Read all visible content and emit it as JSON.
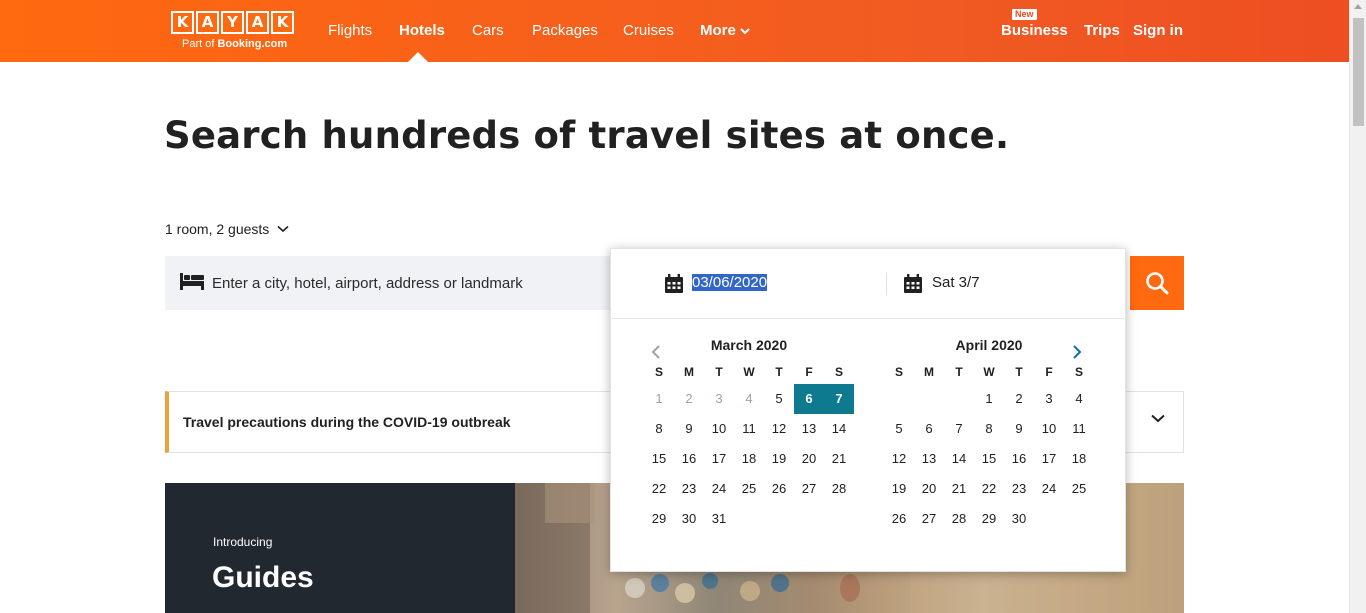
{
  "header": {
    "logo_letters": [
      "K",
      "A",
      "Y",
      "A",
      "K"
    ],
    "logo_sub_prefix": "Part of ",
    "logo_sub_brand": "Booking.com",
    "nav": {
      "flights": "Flights",
      "hotels": "Hotels",
      "cars": "Cars",
      "packages": "Packages",
      "cruises": "Cruises",
      "more": "More"
    },
    "new_badge": "New",
    "business": "Business",
    "trips": "Trips",
    "sign_in": "Sign in"
  },
  "hero": {
    "headline": "Search hundreds of travel sites at once."
  },
  "search": {
    "guests": "1 room, 2 guests",
    "destination_placeholder": "Enter a city, hotel, airport, address or landmark",
    "checkin_value": "03/06/2020",
    "checkout_value": "Sat 3/7"
  },
  "calendar": {
    "weekdays": [
      "S",
      "M",
      "T",
      "W",
      "T",
      "F",
      "S"
    ],
    "months": [
      {
        "title": "March 2020",
        "days": [
          {
            "d": "1",
            "s": "past"
          },
          {
            "d": "2",
            "s": "past"
          },
          {
            "d": "3",
            "s": "past"
          },
          {
            "d": "4",
            "s": "past"
          },
          {
            "d": "5",
            "s": ""
          },
          {
            "d": "6",
            "s": "sel"
          },
          {
            "d": "7",
            "s": "sel"
          },
          {
            "d": "8",
            "s": ""
          },
          {
            "d": "9",
            "s": ""
          },
          {
            "d": "10",
            "s": ""
          },
          {
            "d": "11",
            "s": ""
          },
          {
            "d": "12",
            "s": ""
          },
          {
            "d": "13",
            "s": ""
          },
          {
            "d": "14",
            "s": ""
          },
          {
            "d": "15",
            "s": ""
          },
          {
            "d": "16",
            "s": ""
          },
          {
            "d": "17",
            "s": ""
          },
          {
            "d": "18",
            "s": ""
          },
          {
            "d": "19",
            "s": ""
          },
          {
            "d": "20",
            "s": ""
          },
          {
            "d": "21",
            "s": ""
          },
          {
            "d": "22",
            "s": ""
          },
          {
            "d": "23",
            "s": ""
          },
          {
            "d": "24",
            "s": ""
          },
          {
            "d": "25",
            "s": ""
          },
          {
            "d": "26",
            "s": ""
          },
          {
            "d": "27",
            "s": ""
          },
          {
            "d": "28",
            "s": ""
          },
          {
            "d": "29",
            "s": ""
          },
          {
            "d": "30",
            "s": ""
          },
          {
            "d": "31",
            "s": ""
          }
        ],
        "lead_blanks": 0
      },
      {
        "title": "April 2020",
        "days": [
          {
            "d": "1",
            "s": ""
          },
          {
            "d": "2",
            "s": ""
          },
          {
            "d": "3",
            "s": ""
          },
          {
            "d": "4",
            "s": ""
          },
          {
            "d": "5",
            "s": ""
          },
          {
            "d": "6",
            "s": ""
          },
          {
            "d": "7",
            "s": ""
          },
          {
            "d": "8",
            "s": ""
          },
          {
            "d": "9",
            "s": ""
          },
          {
            "d": "10",
            "s": ""
          },
          {
            "d": "11",
            "s": ""
          },
          {
            "d": "12",
            "s": ""
          },
          {
            "d": "13",
            "s": ""
          },
          {
            "d": "14",
            "s": ""
          },
          {
            "d": "15",
            "s": ""
          },
          {
            "d": "16",
            "s": ""
          },
          {
            "d": "17",
            "s": ""
          },
          {
            "d": "18",
            "s": ""
          },
          {
            "d": "19",
            "s": ""
          },
          {
            "d": "20",
            "s": ""
          },
          {
            "d": "21",
            "s": ""
          },
          {
            "d": "22",
            "s": ""
          },
          {
            "d": "23",
            "s": ""
          },
          {
            "d": "24",
            "s": ""
          },
          {
            "d": "25",
            "s": ""
          },
          {
            "d": "26",
            "s": ""
          },
          {
            "d": "27",
            "s": ""
          },
          {
            "d": "28",
            "s": ""
          },
          {
            "d": "29",
            "s": ""
          },
          {
            "d": "30",
            "s": ""
          }
        ],
        "lead_blanks": 3
      }
    ]
  },
  "covid": {
    "text": "Travel precautions during the COVID-19 outbreak"
  },
  "guides": {
    "intro": "Introducing",
    "title": "Guides"
  },
  "colors": {
    "brand_orange": "#ff690f",
    "selected_day": "#0e7a8f",
    "covid_accent": "#e8a33d",
    "guides_bg": "#212830"
  },
  "icons": {
    "search": "search-icon",
    "bed": "bed-icon",
    "calendar": "calendar-icon",
    "chevron_down": "chevron-down-icon",
    "prev": "chevron-left-icon",
    "next": "chevron-right-icon"
  }
}
